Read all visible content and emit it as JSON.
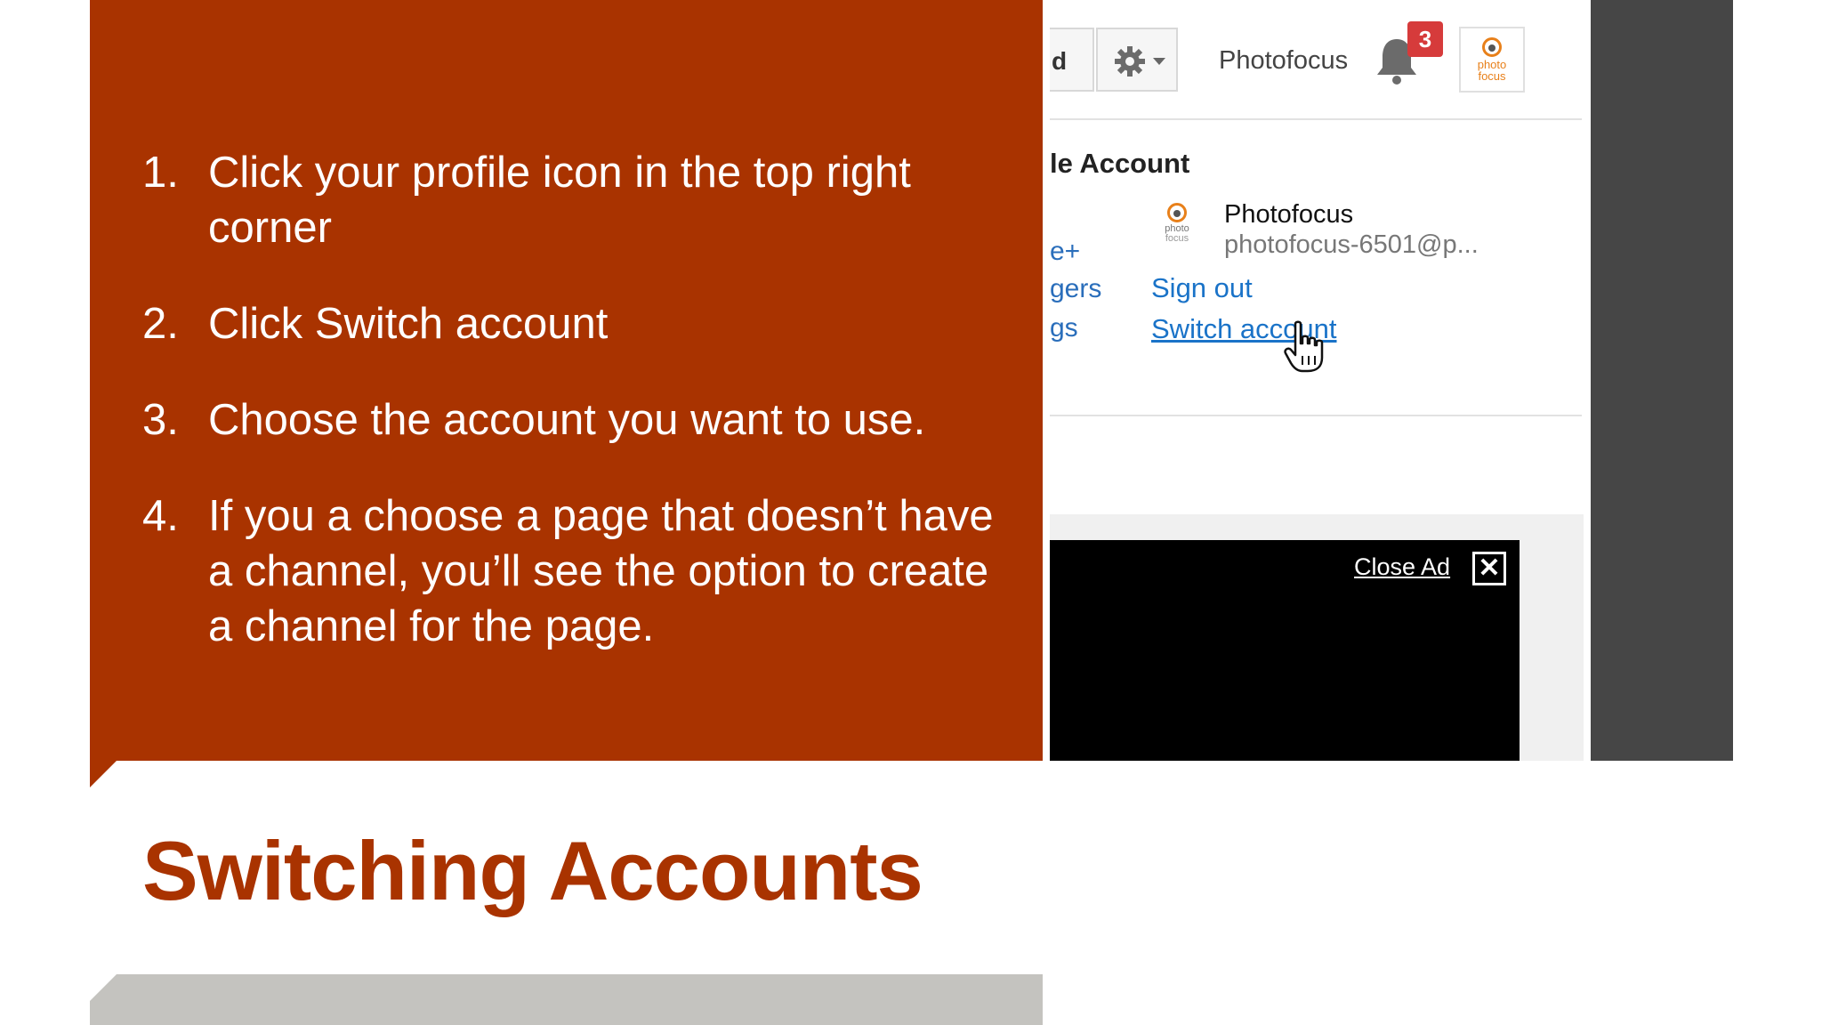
{
  "slide": {
    "title": "Switching Accounts",
    "steps": [
      {
        "num": "1.",
        "text": "Click your profile icon in the top right corner"
      },
      {
        "num": "2.",
        "text": "Click Switch account"
      },
      {
        "num": "3.",
        "text": "Choose the account you want to use."
      },
      {
        "num": "4.",
        "text": "If you a choose a page that doesn’t have a channel, you’ll see the option to create a channel for the page."
      }
    ]
  },
  "screenshot": {
    "toolbar": {
      "left_fragment": "d",
      "account_name": "Photofocus",
      "notification_count": "3",
      "avatar_logo_line1": "photo",
      "avatar_logo_line2": "focus"
    },
    "menu": {
      "section_title": "le Account",
      "left_items": [
        "e+",
        "gers",
        "gs"
      ],
      "profile_name": "Photofocus",
      "profile_email": "photofocus-6501@p...",
      "profile_logo_line1": "photo",
      "profile_logo_line2": "focus",
      "sign_out": "Sign out",
      "switch_account": "Switch account"
    },
    "ad": {
      "close_label": "Close Ad",
      "close_glyph": "✕"
    }
  },
  "colors": {
    "accent": "#A93300",
    "link": "#1a73c8",
    "badge": "#d63b3b",
    "dark_bar": "#464646",
    "bottom_bar": "#C4C3BF"
  },
  "icons": [
    "gear-icon",
    "caret-down-icon",
    "bell-icon",
    "photofocus-logo-icon",
    "hand-cursor-icon",
    "close-icon"
  ]
}
